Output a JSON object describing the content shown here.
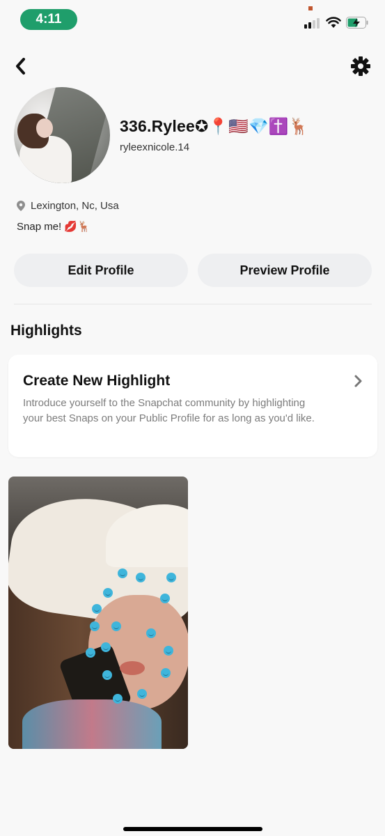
{
  "status_bar": {
    "time": "4:11",
    "signal_bars_active": 2,
    "signal_bars_total": 4,
    "battery_state": "charging"
  },
  "nav": {
    "back_icon": "chevron-left-icon",
    "settings_icon": "gear-icon"
  },
  "profile": {
    "display_name": "336.Rylee✪📍🇺🇸💎✝️🦌",
    "username": "ryleexnicole.14",
    "location": "Lexington, Nc, Usa",
    "bio": "Snap me! 💋🦌"
  },
  "actions": {
    "edit_label": "Edit Profile",
    "preview_label": "Preview Profile"
  },
  "highlights": {
    "section_title": "Highlights",
    "create_card": {
      "title": "Create New Highlight",
      "description": "Introduce yourself to the Snapchat community by highlighting your best Snaps on your Public Profile for as long as you'd like."
    },
    "items": [
      {
        "type": "snap-thumbnail",
        "description": "Selfie with white cowboy hat and blue smiley face stickers"
      }
    ]
  },
  "colors": {
    "time_pill": "#1f9e6b",
    "button_bg": "#eeeff1",
    "card_bg": "#ffffff",
    "page_bg": "#f8f8f8",
    "desc_text": "#7c7c7c"
  }
}
